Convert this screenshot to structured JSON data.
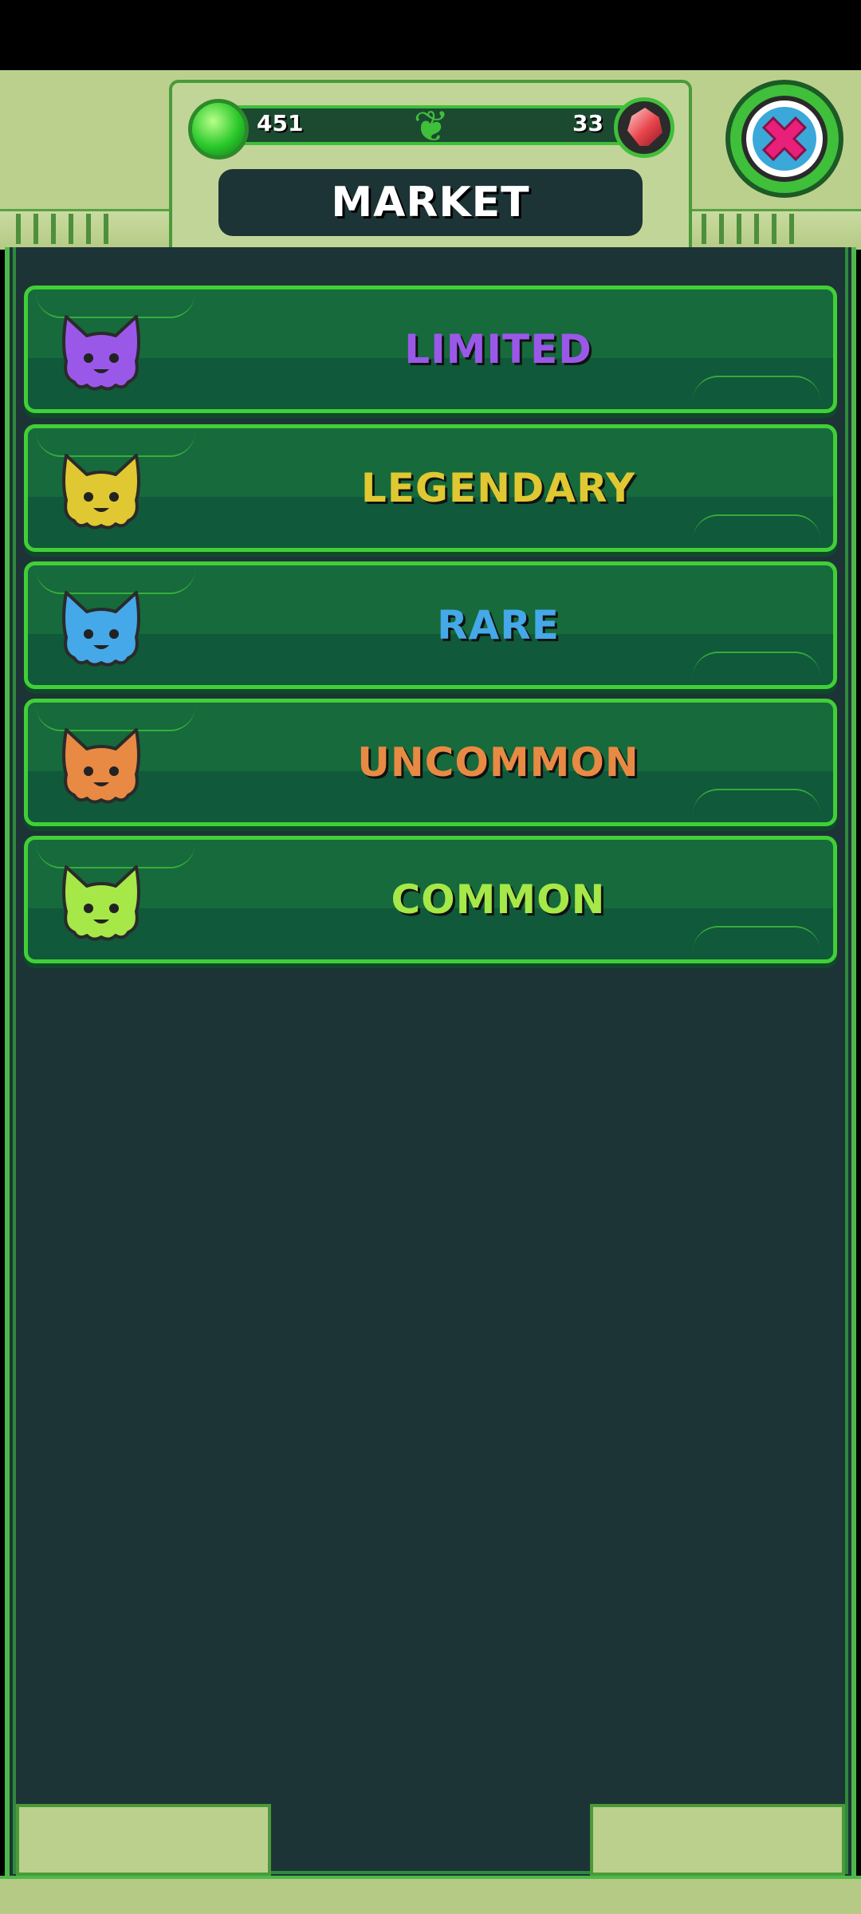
{
  "header": {
    "title": "MARKET",
    "currency_left": "451",
    "currency_right": "33"
  },
  "categories": [
    {
      "label": "LIMITED",
      "color": "#9a58e8",
      "icon": "cat-icon"
    },
    {
      "label": "LEGENDARY",
      "color": "#e0c832",
      "icon": "cat-icon"
    },
    {
      "label": "RARE",
      "color": "#45a8e8",
      "icon": "cat-icon"
    },
    {
      "label": "UNCOMMON",
      "color": "#e88a44",
      "icon": "cat-icon"
    },
    {
      "label": "COMMON",
      "color": "#a6e848",
      "icon": "cat-icon"
    }
  ],
  "colors": {
    "panel_bg": "#1d3436",
    "frame_green": "#4db84a",
    "header_bg": "#bcd08e"
  }
}
